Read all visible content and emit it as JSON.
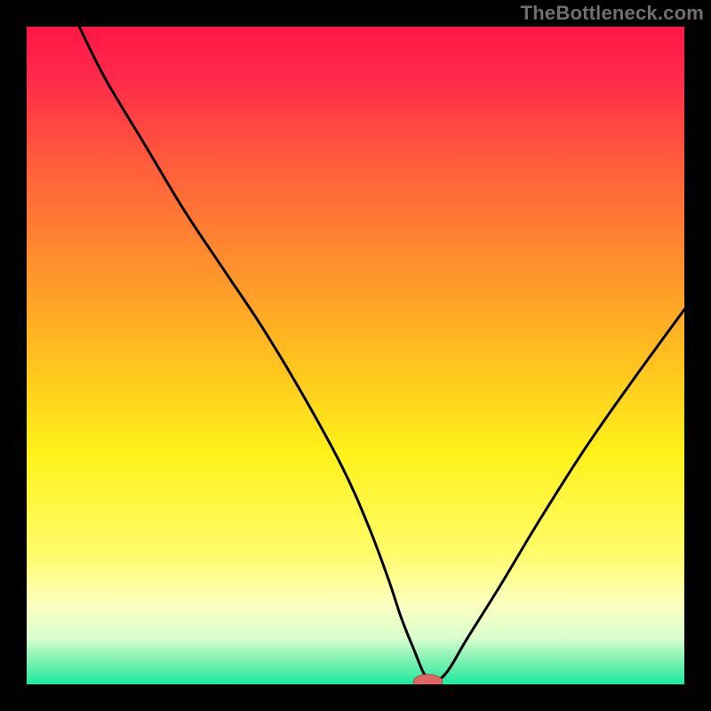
{
  "watermark": "TheBottleneck.com",
  "colors": {
    "frame": "#000000",
    "gradient_stops": [
      {
        "offset": 0.0,
        "color": "#ff1744"
      },
      {
        "offset": 0.08,
        "color": "#ff2a4a"
      },
      {
        "offset": 0.2,
        "color": "#ff5a3c"
      },
      {
        "offset": 0.35,
        "color": "#ff8c2e"
      },
      {
        "offset": 0.5,
        "color": "#ffbf1f"
      },
      {
        "offset": 0.65,
        "color": "#fff21a"
      },
      {
        "offset": 0.8,
        "color": "#fffc6a"
      },
      {
        "offset": 0.88,
        "color": "#fcffc0"
      },
      {
        "offset": 0.93,
        "color": "#d8ffcd"
      },
      {
        "offset": 0.965,
        "color": "#7af0b0"
      },
      {
        "offset": 1.0,
        "color": "#1de9a0"
      }
    ],
    "curve": "#000000",
    "marker_fill": "#e06666",
    "marker_stroke": "#b34747"
  },
  "chart_data": {
    "type": "line",
    "title": "",
    "xlabel": "",
    "ylabel": "",
    "xlim": [
      0,
      100
    ],
    "ylim": [
      0,
      100
    ],
    "grid": false,
    "legend": false,
    "series": [
      {
        "name": "bottleneck-curve",
        "x": [
          8,
          12,
          18,
          24,
          30,
          36,
          42,
          48,
          52,
          55,
          57,
          59,
          60.5,
          62,
          64,
          67,
          72,
          78,
          85,
          92,
          100
        ],
        "y": [
          100,
          92,
          82,
          72,
          63,
          54,
          44,
          33,
          24,
          16,
          10,
          5,
          1.5,
          0.5,
          2,
          7,
          15,
          25,
          36,
          46,
          57
        ]
      }
    ],
    "marker": {
      "name": "optimal-point",
      "x": 61,
      "y": 0.4,
      "rx": 2.2,
      "ry": 1.1
    }
  }
}
